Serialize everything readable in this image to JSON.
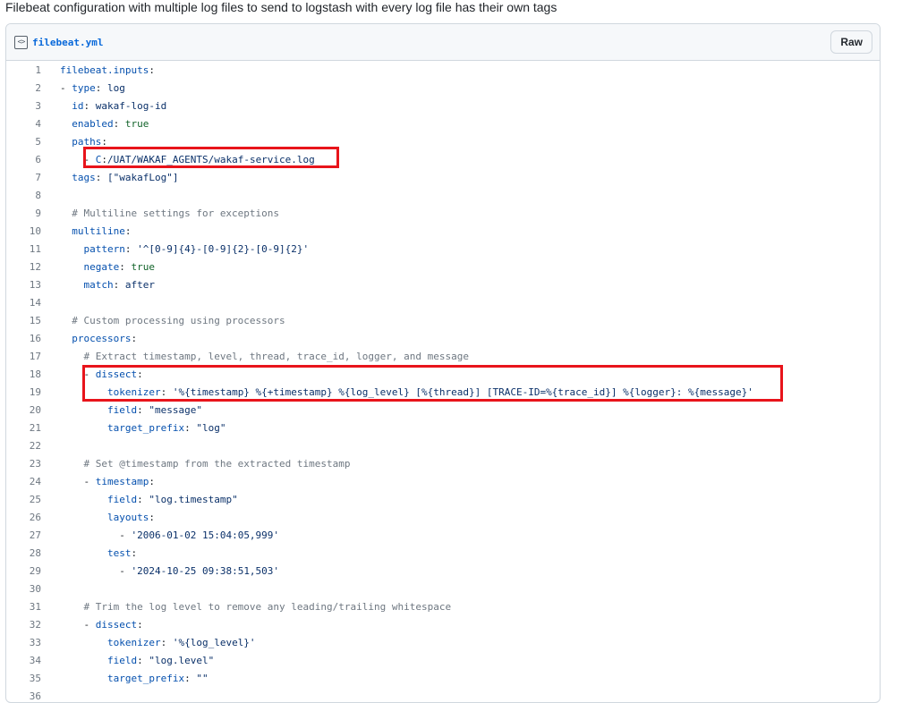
{
  "intro_text": "Filebeat configuration with multiple log files to send to logstash with every log file has their own tags",
  "file": {
    "name": "filebeat.yml",
    "icon": "code-file-icon",
    "raw_label": "Raw"
  },
  "lines": [
    {
      "n": "1",
      "t": "filebeat.inputs:"
    },
    {
      "n": "2",
      "t": "- type: log"
    },
    {
      "n": "3",
      "t": "  id: wakaf-log-id"
    },
    {
      "n": "4",
      "t": "  enabled: true"
    },
    {
      "n": "5",
      "t": "  paths:"
    },
    {
      "n": "6",
      "t": "    - C:/UAT/WAKAF_AGENTS/wakaf-service.log"
    },
    {
      "n": "7",
      "t": "  tags: [\"wakafLog\"]"
    },
    {
      "n": "8",
      "t": ""
    },
    {
      "n": "9",
      "t": "  # Multiline settings for exceptions"
    },
    {
      "n": "10",
      "t": "  multiline:"
    },
    {
      "n": "11",
      "t": "    pattern: '^[0-9]{4}-[0-9]{2}-[0-9]{2}'"
    },
    {
      "n": "12",
      "t": "    negate: true"
    },
    {
      "n": "13",
      "t": "    match: after"
    },
    {
      "n": "14",
      "t": ""
    },
    {
      "n": "15",
      "t": "  # Custom processing using processors"
    },
    {
      "n": "16",
      "t": "  processors:"
    },
    {
      "n": "17",
      "t": "    # Extract timestamp, level, thread, trace_id, logger, and message"
    },
    {
      "n": "18",
      "t": "    - dissect:"
    },
    {
      "n": "19",
      "t": "        tokenizer: '%{timestamp} %{+timestamp} %{log_level} [%{thread}] [TRACE-ID=%{trace_id}] %{logger}: %{message}'"
    },
    {
      "n": "20",
      "t": "        field: \"message\""
    },
    {
      "n": "21",
      "t": "        target_prefix: \"log\""
    },
    {
      "n": "22",
      "t": ""
    },
    {
      "n": "23",
      "t": "    # Set @timestamp from the extracted timestamp"
    },
    {
      "n": "24",
      "t": "    - timestamp:"
    },
    {
      "n": "25",
      "t": "        field: \"log.timestamp\""
    },
    {
      "n": "26",
      "t": "        layouts:"
    },
    {
      "n": "27",
      "t": "          - '2006-01-02 15:04:05,999'"
    },
    {
      "n": "28",
      "t": "        test:"
    },
    {
      "n": "29",
      "t": "          - '2024-10-25 09:38:51,503'"
    },
    {
      "n": "30",
      "t": ""
    },
    {
      "n": "31",
      "t": "    # Trim the log level to remove any leading/trailing whitespace"
    },
    {
      "n": "32",
      "t": "    - dissect:"
    },
    {
      "n": "33",
      "t": "        tokenizer: '%{log_level}'"
    },
    {
      "n": "34",
      "t": "        field: \"log.level\""
    },
    {
      "n": "35",
      "t": "        target_prefix: \"\""
    },
    {
      "n": "36",
      "t": ""
    }
  ],
  "colors": {
    "highlight": "#e8141b",
    "key": "#0550ae",
    "string": "#0a3069",
    "keyword": "#116329",
    "comment": "#6e7781"
  }
}
